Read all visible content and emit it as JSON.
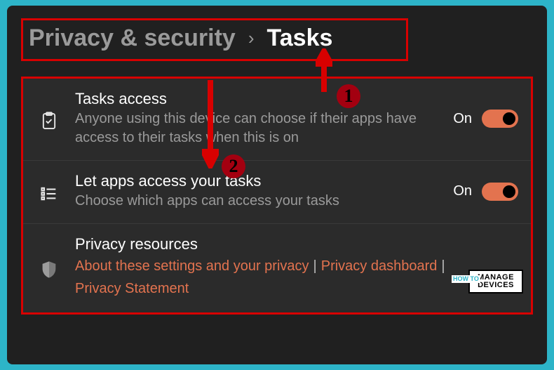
{
  "breadcrumb": {
    "parent": "Privacy & security",
    "current": "Tasks"
  },
  "rows": {
    "tasks_access": {
      "title": "Tasks access",
      "subtitle": "Anyone using this device can choose if their apps have access to their tasks when this is on",
      "state": "On"
    },
    "let_apps": {
      "title": "Let apps access your tasks",
      "subtitle": "Choose which apps can access your tasks",
      "state": "On"
    },
    "resources": {
      "title": "Privacy resources",
      "link1": "About these settings and your privacy",
      "link2": "Privacy dashboard",
      "link3": "Privacy Statement"
    }
  },
  "annotations": {
    "badge1": "1",
    "badge2": "2",
    "logo_top": "MANAGE",
    "logo_bottom": "DEVICES",
    "logo_side": "HOW TO"
  }
}
